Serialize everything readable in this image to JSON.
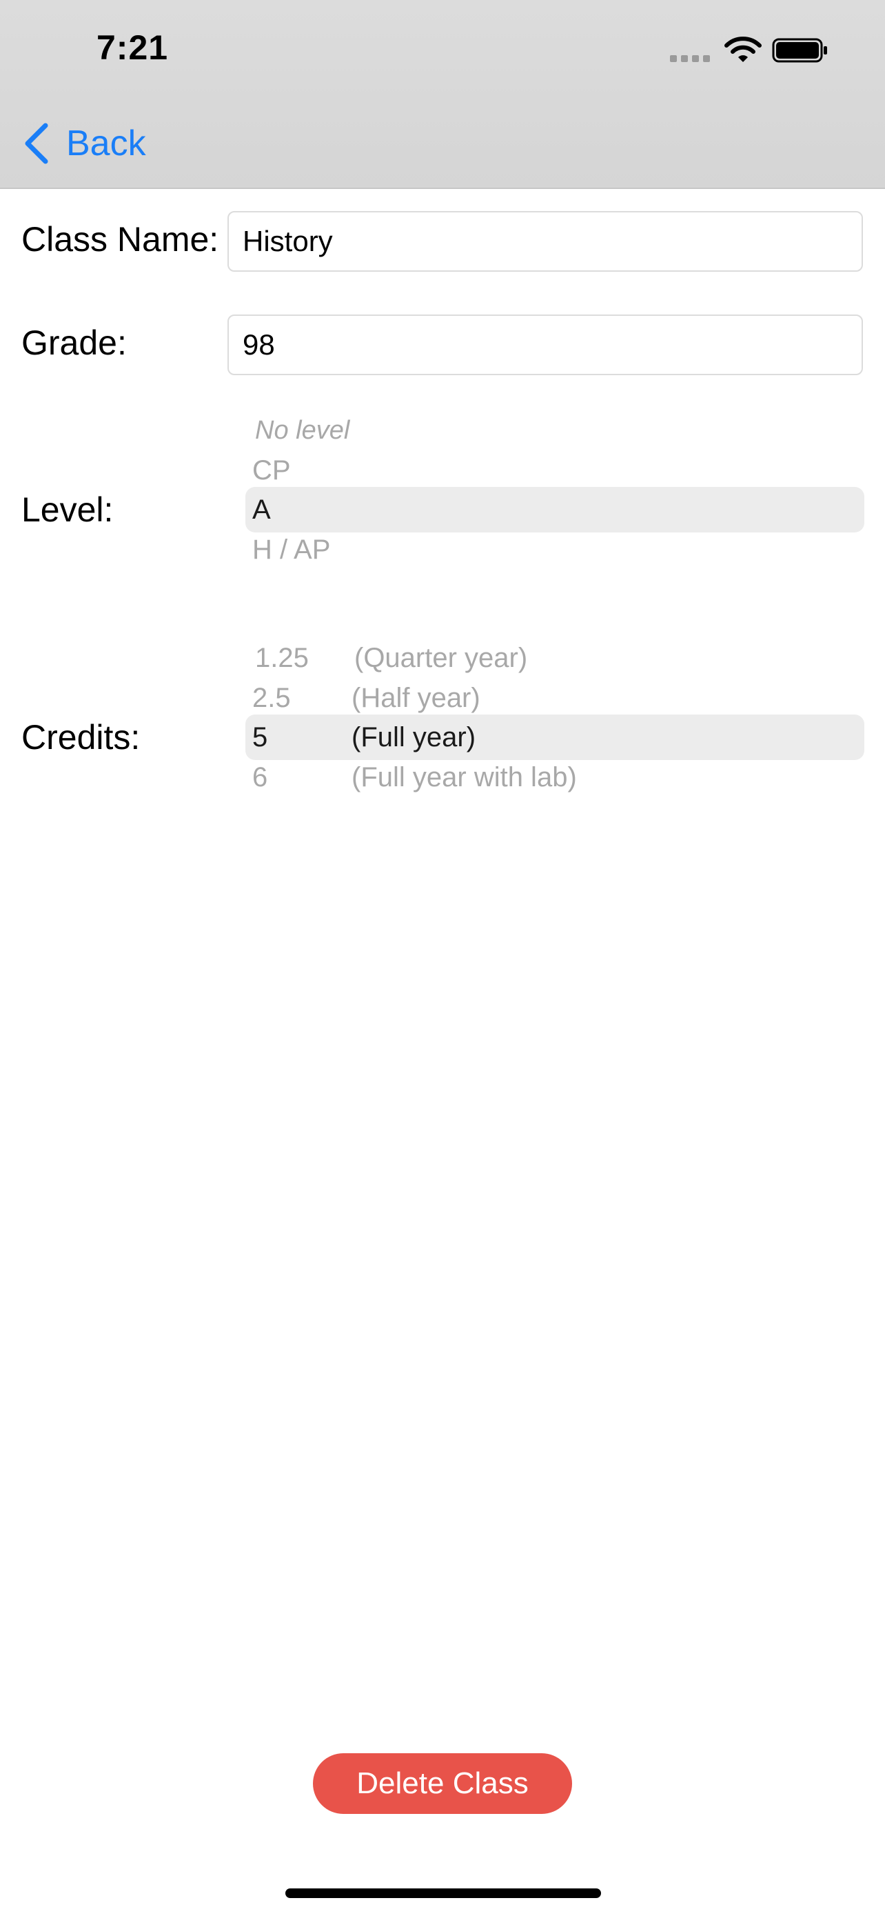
{
  "status_bar": {
    "time": "7:21",
    "icons": [
      "signal-icon",
      "wifi-icon",
      "battery-icon"
    ]
  },
  "nav": {
    "back_label": "Back",
    "back_icon": "chevron-left-icon",
    "accent_color": "#1a7ef7"
  },
  "form": {
    "class_name_label": "Class Name:",
    "class_name_value": "History",
    "grade_label": "Grade:",
    "grade_value": "98",
    "level_label": "Level:",
    "credits_label": "Credits:"
  },
  "level_picker": {
    "options": [
      "No level",
      "CP",
      "A",
      "H / AP"
    ],
    "selected": "A"
  },
  "credits_picker": {
    "options": [
      {
        "value": "1.25",
        "description": "(Quarter year)"
      },
      {
        "value": "2.5",
        "description": "(Half year)"
      },
      {
        "value": "5",
        "description": "(Full year)"
      },
      {
        "value": "6",
        "description": "(Full year with lab)"
      }
    ],
    "selected": "5"
  },
  "actions": {
    "delete_label": "Delete Class",
    "delete_color": "#e8534a"
  }
}
